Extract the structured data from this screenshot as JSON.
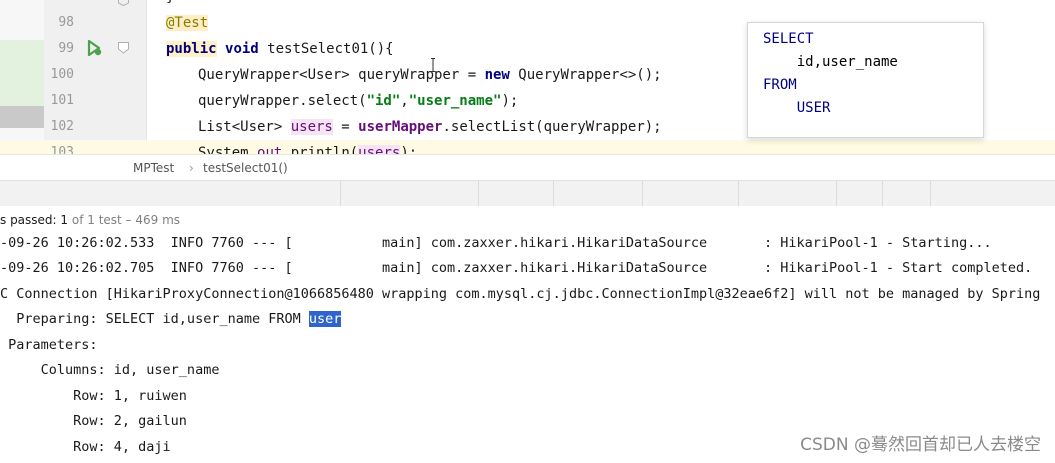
{
  "editor": {
    "lines": [
      {
        "num": "98",
        "parts": [
          {
            "t": "@Test",
            "c": "ann hl-ann"
          }
        ]
      },
      {
        "num": "99",
        "parts": [
          {
            "t": "public",
            "c": "kw hl-pub"
          },
          {
            "t": " ",
            "c": ""
          },
          {
            "t": "void",
            "c": "kw"
          },
          {
            "t": " testSelect01(){",
            "c": ""
          }
        ]
      },
      {
        "num": "100",
        "parts": [
          {
            "t": "QueryWrapper<User> queryWrapper = ",
            "c": ""
          },
          {
            "t": "new",
            "c": "kw"
          },
          {
            "t": " QueryWrapper<>();",
            "c": ""
          }
        ]
      },
      {
        "num": "101",
        "parts": [
          {
            "t": "queryWrapper.select(",
            "c": ""
          },
          {
            "t": "\"id\"",
            "c": "str"
          },
          {
            "t": ",",
            "c": ""
          },
          {
            "t": "\"user_name\"",
            "c": "str"
          },
          {
            "t": ");",
            "c": ""
          }
        ]
      },
      {
        "num": "102",
        "parts": [
          {
            "t": "List<User> ",
            "c": ""
          },
          {
            "t": "users",
            "c": "hl-field"
          },
          {
            "t": " = ",
            "c": ""
          },
          {
            "t": "userMapper",
            "c": "field kw"
          },
          {
            "t": ".selectList(queryWrapper);",
            "c": ""
          }
        ]
      },
      {
        "num": "103",
        "parts": [
          {
            "t": "System.",
            "c": ""
          },
          {
            "t": "out",
            "c": "field"
          },
          {
            "t": ".println(",
            "c": ""
          },
          {
            "t": "users",
            "c": "hl-field"
          },
          {
            "t": ");",
            "c": ""
          }
        ]
      }
    ],
    "top_brace": "}"
  },
  "breadcrumb": {
    "class_name": "MPTest",
    "separator": "›",
    "method_name": "testSelect01()"
  },
  "tooltip": {
    "l1": "SELECT",
    "l2": "    id,user_name",
    "l3": "FROM",
    "l4": "    USER"
  },
  "status": {
    "prefix": "s passed: ",
    "count": "1",
    "suffix": " of 1 test – 469 ms"
  },
  "console": {
    "lines": [
      "-09-26 10:26:02.533  INFO 7760 --- [           main] com.zaxxer.hikari.HikariDataSource       : HikariPool-1 - Starting...",
      "-09-26 10:26:02.705  INFO 7760 --- [           main] com.zaxxer.hikari.HikariDataSource       : HikariPool-1 - Start completed.",
      "C Connection [HikariProxyConnection@1066856480 wrapping com.mysql.cj.jdbc.ConnectionImpl@32eae6f2] will not be managed by Spring",
      "  Preparing: SELECT id,user_name FROM ",
      " Parameters:",
      "     Columns: id, user_name",
      "         Row: 1, ruiwen",
      "         Row: 2, gailun",
      "         Row: 4, daji"
    ],
    "selected": "user"
  },
  "watermark": "CSDN @蓦然回首却已人去楼空"
}
